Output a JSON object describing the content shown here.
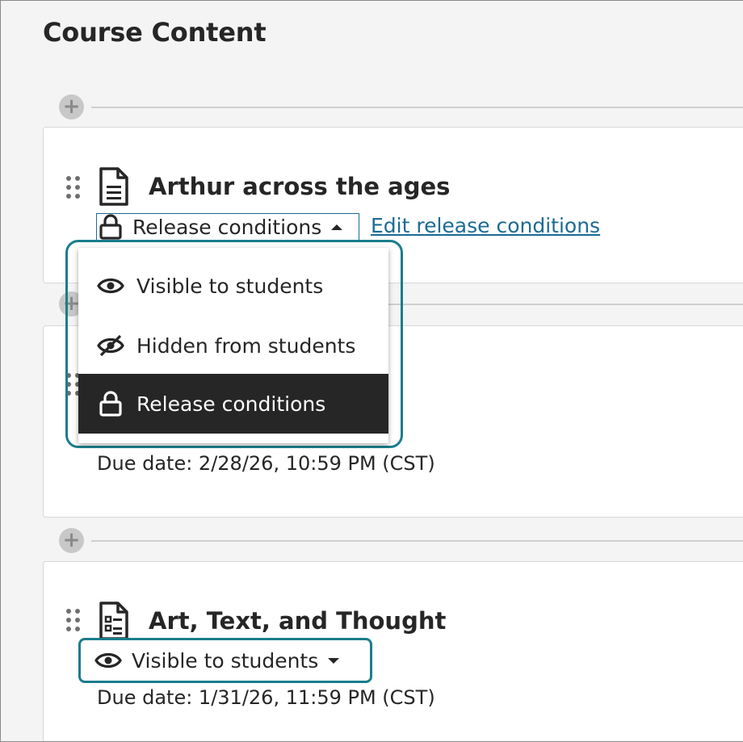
{
  "page": {
    "title": "Course Content"
  },
  "items": [
    {
      "title": "Arthur across the ages",
      "icon": "document-icon",
      "visibility": "Release conditions",
      "edit_link": "Edit release conditions"
    },
    {
      "title": "",
      "due": "Due date: 2/28/26, 10:59 PM (CST)"
    },
    {
      "title": "Art, Text, and Thought",
      "icon": "assignment-icon",
      "visibility": "Visible to students",
      "due": "Due date: 1/31/26, 11:59 PM (CST)"
    }
  ],
  "visibility_menu": {
    "options": [
      {
        "label": "Visible to students",
        "icon": "eye-icon"
      },
      {
        "label": "Hidden from students",
        "icon": "eye-slash-icon"
      },
      {
        "label": "Release conditions",
        "icon": "lock-icon",
        "selected": true
      }
    ]
  },
  "colors": {
    "focus": "#1a7d8c",
    "link": "#1b6b94",
    "selected_bg": "#262626"
  }
}
